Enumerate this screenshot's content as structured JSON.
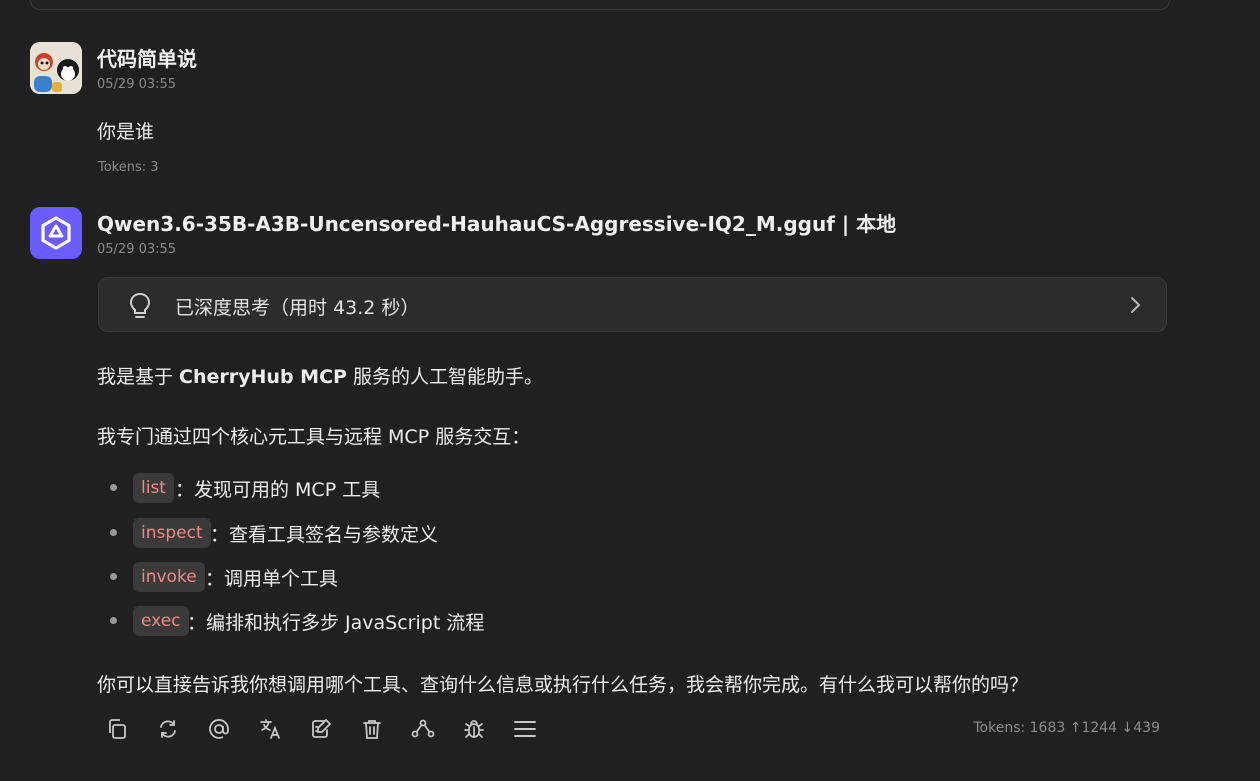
{
  "messages": [
    {
      "role": "user",
      "name": "代码简单说",
      "time": "05/29 03:55",
      "text": "你是谁",
      "tokens": "Tokens: 3"
    },
    {
      "role": "assistant",
      "name": "Qwen3.6-35B-A3B-Uncensored-HauhauCS-Aggressive-IQ2_M.gguf | 本地",
      "time": "05/29 03:55",
      "thinking_label": "已深度思考（用时 43.2 秒）",
      "p1_prefix": "我是基于 ",
      "p1_bold": "CherryHub MCP",
      "p1_suffix": " 服务的人工智能助手。",
      "p2": "我专门通过四个核心元工具与远程 MCP 服务交互：",
      "list": [
        {
          "code": "list",
          "desc": "：发现可用的 MCP 工具"
        },
        {
          "code": "inspect",
          "desc": "：查看工具签名与参数定义"
        },
        {
          "code": "invoke",
          "desc": "：调用单个工具"
        },
        {
          "code": "exec",
          "desc": "：编排和执行多步 JavaScript 流程"
        }
      ],
      "p3": "你可以直接告诉我你想调用哪个工具、查询什么信息或执行什么任务，我会帮你完成。有什么我可以帮你的吗？",
      "tokens": "Tokens: 1683 ↑1244 ↓439"
    }
  ],
  "toolbar": [
    "copy-icon",
    "regenerate-icon",
    "mention-icon",
    "translate-icon",
    "edit-icon",
    "delete-icon",
    "branch-icon",
    "debug-icon",
    "menu-icon"
  ]
}
